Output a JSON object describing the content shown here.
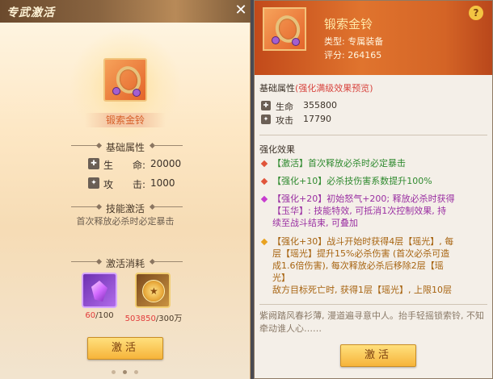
{
  "left_panel": {
    "title": "专武激活",
    "close_glyph": "✕",
    "item_name": "锻索金铃",
    "base_attr_title": "基础属性",
    "attributes": [
      {
        "label": "生　　命:",
        "value": "20000",
        "icon": "hp-icon",
        "glyph": "✚"
      },
      {
        "label": "攻　　击:",
        "value": "1000",
        "icon": "attack-icon",
        "glyph": "✦"
      }
    ],
    "skill_title": "技能激活",
    "skill_desc": "首次释放必杀时必定暴击",
    "cost_title": "激活消耗",
    "costs": [
      {
        "name": "crystal",
        "have": "60",
        "need": "/100",
        "have_color": "#e23b3b"
      },
      {
        "name": "coin",
        "have": "503850",
        "need": "/300万",
        "have_color": "#e23b3b"
      }
    ],
    "activate_label": "激活"
  },
  "right_panel": {
    "item_name": "锻索金铃",
    "type_line": "类型: 专属装备",
    "score_line": "评分: 264165",
    "help_glyph": "?",
    "base_attr_title": "基础属性",
    "base_attr_note": "(强化满级效果预览)",
    "attributes": [
      {
        "label": "生命",
        "value": "355800",
        "icon": "hp-icon",
        "glyph": "✚"
      },
      {
        "label": "攻击",
        "value": "17790",
        "icon": "attack-icon",
        "glyph": "✦"
      }
    ],
    "effect_title": "强化效果",
    "effects": [
      {
        "lines": [
          "【激活】首次释放必杀时必定暴击"
        ],
        "color": "#2f8a2f",
        "bullet_color": "#e0543a"
      },
      {
        "lines": [
          "【强化+10】必杀技伤害系数提升100%"
        ],
        "color": "#2f8a2f",
        "bullet_color": "#e0543a"
      },
      {
        "lines": [
          "【强化+20】初始怒气+200; 释放必杀时获得",
          "【玉华】: 技能特效, 可抵消1次控制效果, 持",
          "续至战斗结束, 可叠加"
        ],
        "color": "#9a2fa2",
        "bullet_color": "#c73ccf"
      },
      {
        "lines": [
          "【强化+30】战斗开始时获得4层【瑶光】, 每",
          "层【瑶光】提升15%必杀伤害 (首次必杀可造",
          "成1.6倍伤害), 每次释放必杀后移除2层【瑶",
          "光】",
          "敌方目标死亡时, 获得1层【瑶光】, 上限10层"
        ],
        "color": "#a76411",
        "bullet_color": "#e8a21f"
      }
    ],
    "flavor_text": "紫阙踏风春衫薄, 漫道遍寻意中人。抬手轻摇锁索铃, 不知牵动谁人心……",
    "activate_label": "激活"
  }
}
